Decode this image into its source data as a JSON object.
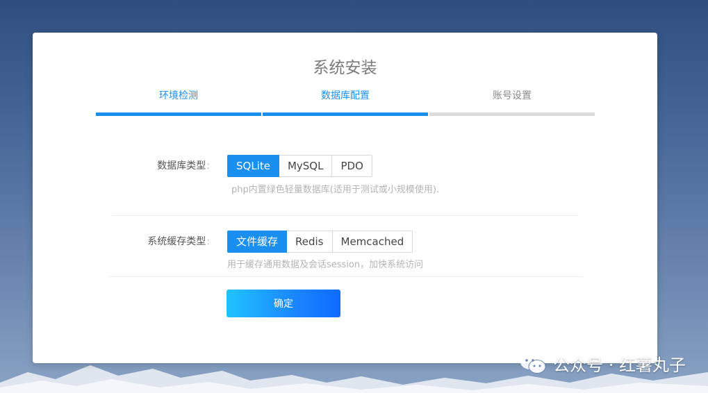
{
  "title": "系统安装",
  "steps": [
    {
      "label": "环境检测",
      "state": "active"
    },
    {
      "label": "数据库配置",
      "state": "active"
    },
    {
      "label": "账号设置",
      "state": "inactive"
    }
  ],
  "db": {
    "label": "数据库类型",
    "options": [
      "SQLite",
      "MySQL",
      "PDO"
    ],
    "selected": "SQLite",
    "hint": "php内置绿色轻量数据库(适用于测试或小规模使用)."
  },
  "cache": {
    "label": "系统缓存类型",
    "options": [
      "文件缓存",
      "Redis",
      "Memcached"
    ],
    "selected": "文件缓存",
    "hint": "用于缓存通用数据及会话session，加快系统访问"
  },
  "confirm_label": "确定",
  "watermark": "公众号 · 红薯丸子",
  "colors": {
    "accent": "#1b8ff0",
    "inactive_bar": "#dcdcdc"
  }
}
